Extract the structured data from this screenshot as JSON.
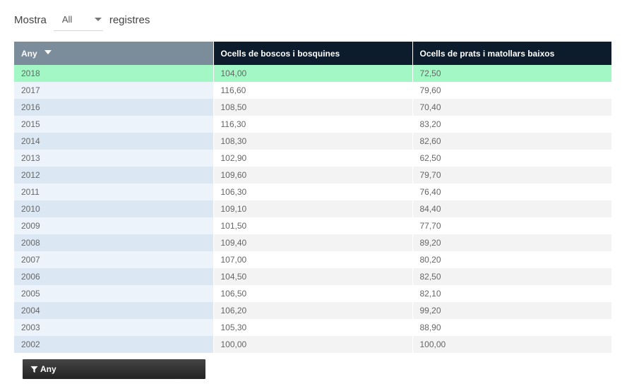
{
  "length_menu": {
    "prefix": "Mostra",
    "selected": "All",
    "suffix": "registres"
  },
  "table": {
    "columns": [
      "Any",
      "Ocells de boscos i bosquines",
      "Ocells de prats i matollars baixos"
    ],
    "sorted_column": "Any",
    "sort_direction": "descending",
    "selected_row": "2018",
    "rows": [
      [
        "2018",
        "104,00",
        "72,50"
      ],
      [
        "2017",
        "116,60",
        "79,60"
      ],
      [
        "2016",
        "108,50",
        "70,40"
      ],
      [
        "2015",
        "116,30",
        "83,20"
      ],
      [
        "2014",
        "108,30",
        "82,60"
      ],
      [
        "2013",
        "102,90",
        "62,50"
      ],
      [
        "2012",
        "109,60",
        "79,70"
      ],
      [
        "2011",
        "106,30",
        "76,40"
      ],
      [
        "2010",
        "109,10",
        "84,40"
      ],
      [
        "2009",
        "101,50",
        "77,70"
      ],
      [
        "2008",
        "109,40",
        "89,20"
      ],
      [
        "2007",
        "107,00",
        "80,20"
      ],
      [
        "2006",
        "104,50",
        "82,50"
      ],
      [
        "2005",
        "106,50",
        "82,10"
      ],
      [
        "2004",
        "106,20",
        "99,20"
      ],
      [
        "2003",
        "105,30",
        "88,90"
      ],
      [
        "2002",
        "100,00",
        "100,00"
      ]
    ]
  },
  "filter": {
    "label": "Any",
    "icon": "filter-icon"
  },
  "colors": {
    "header_sorted": "#7b8c9a",
    "header": "#0c1c2c",
    "selected_row": "#a3f7c4",
    "filter_button": "#333333"
  }
}
